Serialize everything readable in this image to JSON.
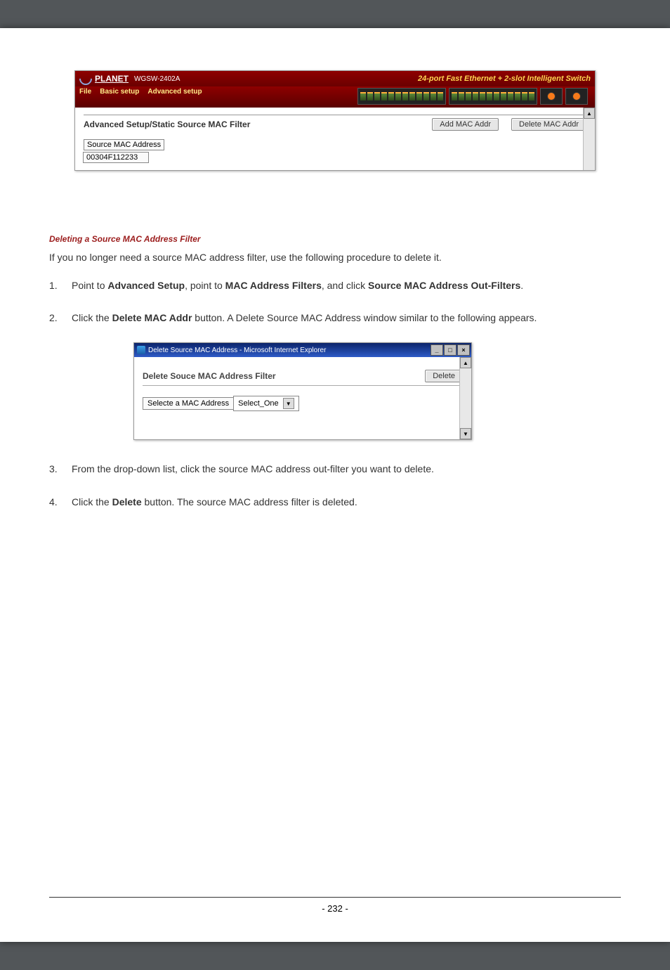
{
  "screenshot1": {
    "brand": "PLANET",
    "model": "WGSW-2402A",
    "tagline": "24-port Fast Ethernet + 2-slot Intelligent Switch",
    "menu": {
      "file": "File",
      "basic": "Basic setup",
      "advanced": "Advanced setup"
    },
    "section_title": "Advanced Setup/Static Source MAC Filter",
    "add_btn": "Add MAC Addr",
    "del_btn": "Delete MAC Addr",
    "src_label": "Source MAC Address",
    "src_value": "00304F112233"
  },
  "heading": "Deleting a Source MAC Address Filter",
  "intro": "If you no longer need a source MAC address filter, use the following procedure to delete it.",
  "steps": {
    "s1": {
      "num": "1.",
      "a": "Point to ",
      "b": "Advanced Setup",
      "c": ", point to ",
      "d": "MAC Address Filters",
      "e": ", and click ",
      "f": "Source MAC Address Out-Filters",
      "g": "."
    },
    "s2": {
      "num": "2.",
      "a": "Click the ",
      "b": "Delete MAC Addr",
      "c": " button. A Delete Source MAC Address window similar to the following appears."
    },
    "s3": {
      "num": "3.",
      "text": "From the drop-down list, click the source MAC address out-filter you want to delete."
    },
    "s4": {
      "num": "4.",
      "a": "Click the ",
      "b": "Delete",
      "c": " button. The source MAC address filter is deleted."
    }
  },
  "screenshot2": {
    "ie_title": "Delete Source MAC Address - Microsoft Internet Explorer",
    "section": "Delete Souce MAC Address Filter",
    "del_btn": "Delete",
    "dd_label": "Selecte a MAC Address",
    "dd_value": "Select_One"
  },
  "page_num": "- 232 -"
}
